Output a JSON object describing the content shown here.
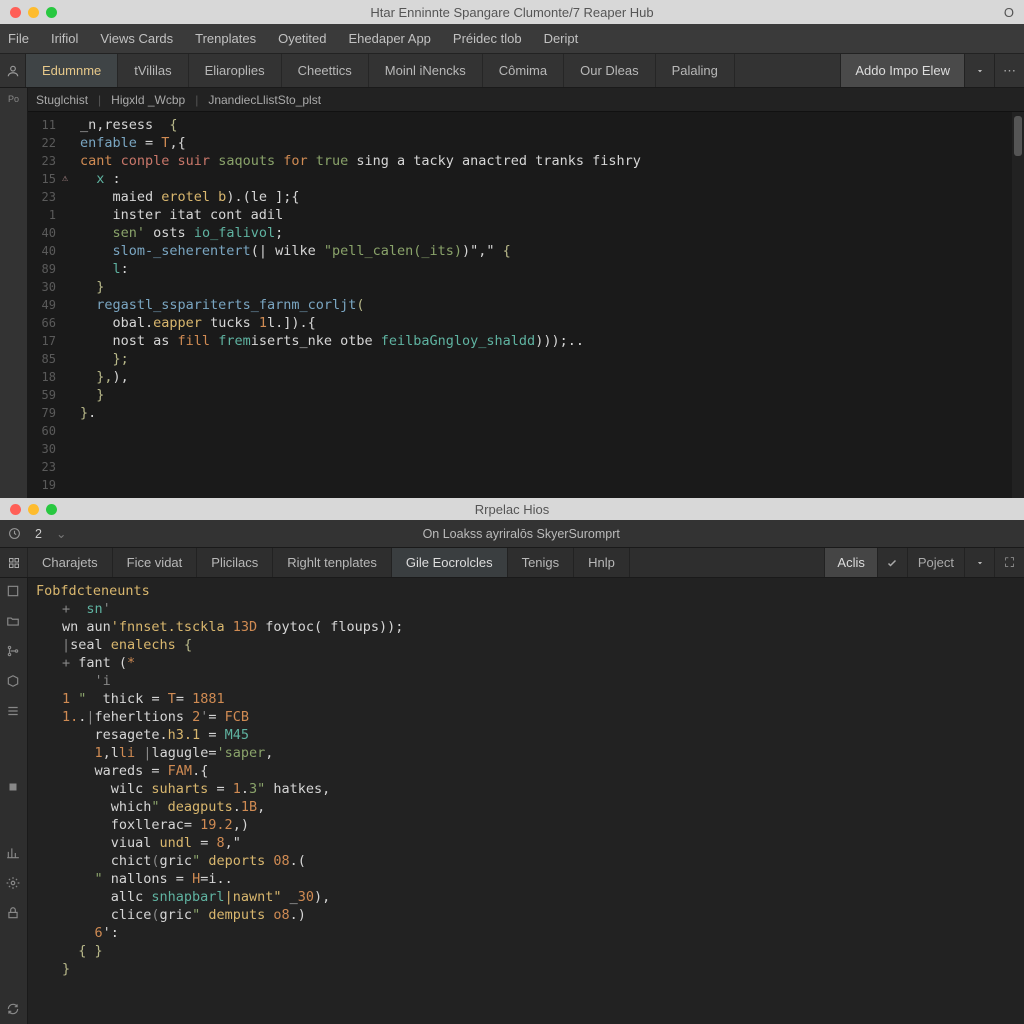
{
  "window1": {
    "title": "Htar Enninnte Spangare Clumonte/7 Reaper Hub",
    "right": "O",
    "menu": [
      "File",
      "Irifiol",
      "Views Cards",
      "Trenplates",
      "Oyetited",
      "Ehedaper App",
      "Préidec tlob",
      "Deript"
    ],
    "tabs": [
      "Edumnme",
      "tVililas",
      "Eliaroplies",
      "Cheettics",
      "Moinl iNencks",
      "Cômima",
      "Our Dleas",
      "Palaling"
    ],
    "active_tab": 0,
    "right_button": "Addo Impo Elew",
    "breadcrumb": [
      "Stuglchist",
      "Higxld _Wcbp",
      "JnandiecLlistSto_plst"
    ],
    "gutter": [
      "11",
      "22",
      "23",
      "15",
      "23",
      "1",
      "40",
      "40",
      "89",
      "30",
      "49",
      "66",
      "17",
      "85",
      "18",
      "59",
      "79",
      "60",
      "30",
      "23",
      "19"
    ],
    "code_lines": [
      [
        {
          "c": "k-white",
          "t": "_n,resess  "
        },
        {
          "c": "k-br",
          "t": "{"
        }
      ],
      [
        {
          "c": "k-white",
          "t": ""
        }
      ],
      [
        {
          "c": "k-blue",
          "t": "enfable"
        },
        {
          "c": "k-white",
          "t": " = "
        },
        {
          "c": "k-orange",
          "t": "T"
        },
        {
          "c": "k-white",
          "t": ",{"
        }
      ],
      [
        {
          "c": "k-orange",
          "t": "cant "
        },
        {
          "c": "k-red",
          "t": "conple suir "
        },
        {
          "c": "k-green",
          "t": "saqouts "
        },
        {
          "c": "k-orange",
          "t": "for "
        },
        {
          "c": "k-green",
          "t": "true "
        },
        {
          "c": "k-white",
          "t": "sing a tacky anactred tranks fishry"
        }
      ],
      [
        {
          "c": "k-white",
          "t": "  "
        },
        {
          "c": "k-teal",
          "t": "x"
        },
        {
          "c": "k-white",
          "t": " :"
        }
      ],
      [
        {
          "c": "k-white",
          "t": "    maied "
        },
        {
          "c": "k-yellow",
          "t": "erotel b"
        },
        {
          "c": "k-white",
          "t": ").(le ];{"
        }
      ],
      [
        {
          "c": "k-white",
          "t": "    inster itat cont adil"
        }
      ],
      [
        {
          "c": "k-white",
          "t": ""
        }
      ],
      [
        {
          "c": "k-white",
          "t": "    "
        },
        {
          "c": "k-green",
          "t": "sen'"
        },
        {
          "c": "k-white",
          "t": " osts "
        },
        {
          "c": "k-teal",
          "t": "io_falivol"
        },
        {
          "c": "k-white",
          "t": ";"
        }
      ],
      [
        {
          "c": "k-white",
          "t": ""
        }
      ],
      [
        {
          "c": "k-white",
          "t": "    "
        },
        {
          "c": "k-blue",
          "t": "slom-_seherentert"
        },
        {
          "c": "k-white",
          "t": "(| wilke "
        },
        {
          "c": "k-green",
          "t": "\"pell_calen(_its)"
        },
        {
          "c": "k-white",
          "t": ")\",\" "
        },
        {
          "c": "k-br",
          "t": "{"
        }
      ],
      [
        {
          "c": "k-white",
          "t": "    "
        },
        {
          "c": "k-teal",
          "t": "l"
        },
        {
          "c": "k-white",
          "t": ":"
        }
      ],
      [
        {
          "c": "k-white",
          "t": "  "
        },
        {
          "c": "k-br",
          "t": "}"
        }
      ],
      [
        {
          "c": "k-white",
          "t": "  "
        },
        {
          "c": "k-blue",
          "t": "regastl_sspariterts_farnm_corljt"
        },
        {
          "c": "k-br",
          "t": "("
        }
      ],
      [
        {
          "c": "k-white",
          "t": "    obal."
        },
        {
          "c": "k-yellow",
          "t": "eapper "
        },
        {
          "c": "k-white",
          "t": "tucks "
        },
        {
          "c": "k-orange",
          "t": "1"
        },
        {
          "c": "k-white",
          "t": "l.]).{"
        }
      ],
      [
        {
          "c": "k-white",
          "t": "    nost as "
        },
        {
          "c": "k-orange",
          "t": "fill "
        },
        {
          "c": "k-teal",
          "t": "frem"
        },
        {
          "c": "k-white",
          "t": "iserts_nke otbe "
        },
        {
          "c": "k-teal",
          "t": "feilbaGngloy_shaldd"
        },
        {
          "c": "k-white",
          "t": ")));.."
        }
      ],
      [
        {
          "c": "k-white",
          "t": ""
        }
      ],
      [
        {
          "c": "k-white",
          "t": "    "
        },
        {
          "c": "k-br",
          "t": "};"
        }
      ],
      [
        {
          "c": "k-white",
          "t": "  "
        },
        {
          "c": "k-br",
          "t": "},"
        },
        {
          "c": "k-white",
          "t": "),"
        }
      ],
      [
        {
          "c": "k-white",
          "t": "  "
        },
        {
          "c": "k-br",
          "t": "}"
        }
      ],
      [
        {
          "c": "k-br",
          "t": "}"
        },
        {
          "c": "k-white",
          "t": "."
        }
      ],
      [
        {
          "c": "k-white",
          "t": ""
        }
      ]
    ]
  },
  "window2": {
    "title": "Rrpelac Hios",
    "subbar_left": "2",
    "subbar_center": "On Loakss ayriralōs SkyerSuromprt",
    "tabs": [
      "Charajets",
      "Fice vidat",
      "Plicilacs",
      "Righlt tenplates",
      "Gile Eocrolcles",
      "Tenigs",
      "Hnlp"
    ],
    "active_tab": 4,
    "right_button": "Aclis",
    "right_label": "Poject",
    "code_header": "Fobfdcteneunts",
    "code_lines": [
      [
        {
          "c": "k-gray",
          "t": "+  "
        },
        {
          "c": "k-teal",
          "t": "sn"
        },
        {
          "c": "k-gray",
          "t": "'"
        }
      ],
      [
        {
          "c": "k-white",
          "t": "wn aun"
        },
        {
          "c": "k-yellow",
          "t": "'fnnset.tsckla "
        },
        {
          "c": "k-orange",
          "t": "13D "
        },
        {
          "c": "k-white",
          "t": "foytoc( floups));"
        }
      ],
      [
        {
          "c": "k-gray",
          "t": "|"
        },
        {
          "c": "k-white",
          "t": "seal "
        },
        {
          "c": "k-yellow",
          "t": "enalechs "
        },
        {
          "c": "k-br",
          "t": "{"
        }
      ],
      [
        {
          "c": "k-gray",
          "t": "+ "
        },
        {
          "c": "k-white",
          "t": "fant ("
        },
        {
          "c": "k-orange",
          "t": "*"
        }
      ],
      [
        {
          "c": "k-white",
          "t": "    "
        },
        {
          "c": "k-gray",
          "t": "'i"
        }
      ],
      [
        {
          "c": "k-orange",
          "t": "1"
        },
        {
          "c": "k-white",
          "t": " "
        },
        {
          "c": "k-green",
          "t": "\""
        },
        {
          "c": "k-white",
          "t": "  thick "
        },
        {
          "c": "k-white",
          "t": "= "
        },
        {
          "c": "k-orange",
          "t": "T"
        },
        {
          "c": "k-white",
          "t": "= "
        },
        {
          "c": "k-orange",
          "t": "1881"
        }
      ],
      [
        {
          "c": "k-orange",
          "t": "1."
        },
        {
          "c": "k-white",
          "t": "."
        },
        {
          "c": "k-gray",
          "t": "|"
        },
        {
          "c": "k-white",
          "t": "feherltions "
        },
        {
          "c": "k-orange",
          "t": "2"
        },
        {
          "c": "k-gray",
          "t": "'"
        },
        {
          "c": "k-white",
          "t": "= "
        },
        {
          "c": "k-orange",
          "t": "FCB"
        }
      ],
      [
        {
          "c": "k-white",
          "t": "    resagete."
        },
        {
          "c": "k-yellow",
          "t": "h3.1 "
        },
        {
          "c": "k-white",
          "t": "= "
        },
        {
          "c": "k-teal",
          "t": "M45"
        }
      ],
      [
        {
          "c": "k-white",
          "t": "    "
        },
        {
          "c": "k-orange",
          "t": "1"
        },
        {
          "c": "k-white",
          "t": ",l"
        },
        {
          "c": "k-orange",
          "t": "li "
        },
        {
          "c": "k-gray",
          "t": "|"
        },
        {
          "c": "k-white",
          "t": "lagugle="
        },
        {
          "c": "k-green",
          "t": "'saper"
        },
        {
          "c": "k-white",
          "t": ","
        }
      ],
      [
        {
          "c": "k-white",
          "t": "    wareds = "
        },
        {
          "c": "k-orange",
          "t": "FAM"
        },
        {
          "c": "k-white",
          "t": ".{"
        }
      ],
      [
        {
          "c": "k-white",
          "t": "      wilc "
        },
        {
          "c": "k-yellow",
          "t": "suharts "
        },
        {
          "c": "k-white",
          "t": "= "
        },
        {
          "c": "k-orange",
          "t": "1"
        },
        {
          "c": "k-white",
          "t": "."
        },
        {
          "c": "k-green",
          "t": "3\" "
        },
        {
          "c": "k-white",
          "t": "hatkes,"
        }
      ],
      [
        {
          "c": "k-white",
          "t": "      which"
        },
        {
          "c": "k-green",
          "t": "\" "
        },
        {
          "c": "k-yellow",
          "t": "deagputs"
        },
        {
          "c": "k-white",
          "t": "."
        },
        {
          "c": "k-orange",
          "t": "1B"
        },
        {
          "c": "k-white",
          "t": ","
        }
      ],
      [
        {
          "c": "k-white",
          "t": "      foxllerac= "
        },
        {
          "c": "k-orange",
          "t": "19.2"
        },
        {
          "c": "k-white",
          "t": ",)"
        }
      ],
      [
        {
          "c": "k-white",
          "t": "      viual "
        },
        {
          "c": "k-yellow",
          "t": "undl "
        },
        {
          "c": "k-white",
          "t": "= "
        },
        {
          "c": "k-orange",
          "t": "8"
        },
        {
          "c": "k-white",
          "t": ",\""
        }
      ],
      [
        {
          "c": "k-white",
          "t": "      chict"
        },
        {
          "c": "k-gray",
          "t": "("
        },
        {
          "c": "k-white",
          "t": "gric"
        },
        {
          "c": "k-green",
          "t": "\" "
        },
        {
          "c": "k-yellow",
          "t": "deports "
        },
        {
          "c": "k-orange",
          "t": "08"
        },
        {
          "c": "k-white",
          "t": ".("
        }
      ],
      [
        {
          "c": "k-white",
          "t": "    "
        },
        {
          "c": "k-green",
          "t": "\" "
        },
        {
          "c": "k-white",
          "t": "nallons = "
        },
        {
          "c": "k-orange",
          "t": "H"
        },
        {
          "c": "k-white",
          "t": "=i.."
        }
      ],
      [
        {
          "c": "k-white",
          "t": "      allc "
        },
        {
          "c": "k-teal",
          "t": "snhapbarl"
        },
        {
          "c": "k-yellow",
          "t": "|nawnt\" "
        },
        {
          "c": "k-white",
          "t": "_"
        },
        {
          "c": "k-orange",
          "t": "30"
        },
        {
          "c": "k-white",
          "t": "),"
        }
      ],
      [
        {
          "c": "k-white",
          "t": "      clice"
        },
        {
          "c": "k-gray",
          "t": "("
        },
        {
          "c": "k-white",
          "t": "gric"
        },
        {
          "c": "k-green",
          "t": "\" "
        },
        {
          "c": "k-yellow",
          "t": "demputs "
        },
        {
          "c": "k-orange",
          "t": "o8"
        },
        {
          "c": "k-white",
          "t": ".)"
        }
      ],
      [
        {
          "c": "k-white",
          "t": "    "
        },
        {
          "c": "k-orange",
          "t": "6"
        },
        {
          "c": "k-white",
          "t": "':"
        }
      ],
      [
        {
          "c": "k-white",
          "t": "  "
        },
        {
          "c": "k-br",
          "t": "{ }"
        }
      ],
      [
        {
          "c": "k-br",
          "t": "}"
        }
      ]
    ]
  }
}
